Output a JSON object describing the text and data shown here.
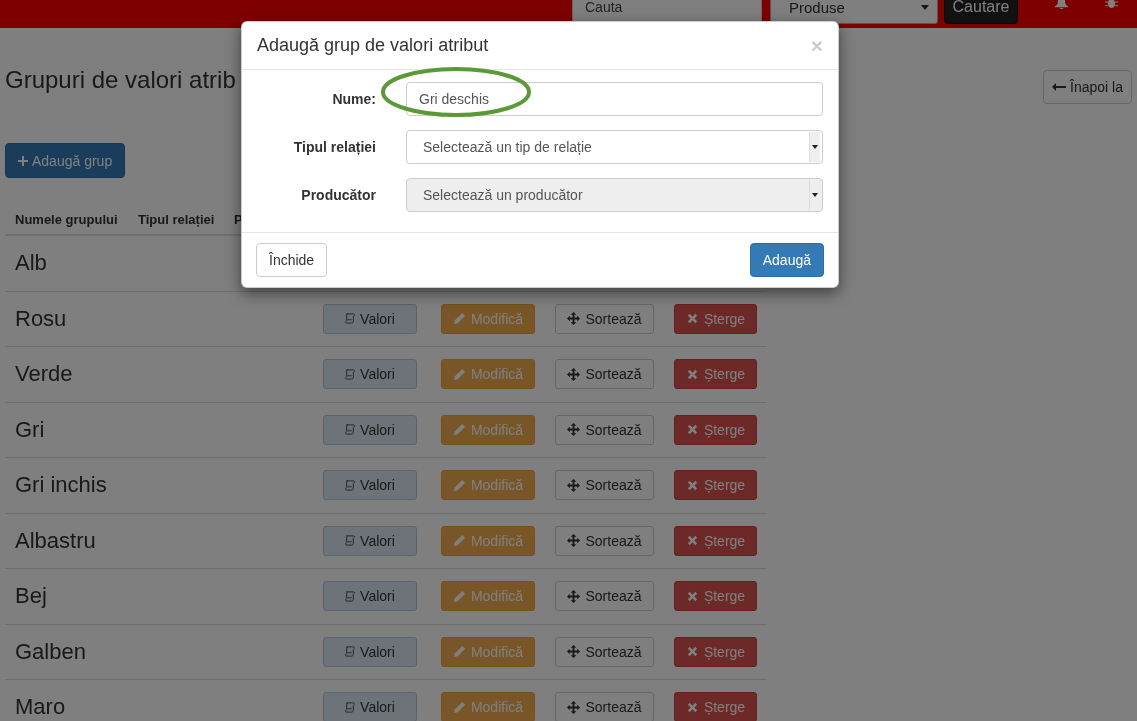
{
  "navbar": {
    "search": {
      "placeholder": "Cauta"
    },
    "category_select": {
      "value": "Produse"
    },
    "search_button": "Cautare"
  },
  "page": {
    "title": "Grupuri de valori atrib",
    "back_button": "Înapoi la",
    "add_button": "Adaugă grup",
    "table": {
      "columns": [
        "Numele grupului",
        "Tipul relației",
        "P"
      ],
      "rows": [
        {
          "name": "Alb"
        },
        {
          "name": "Rosu",
          "buttons": [
            {
              "kind": "values",
              "label": "Valori"
            },
            {
              "kind": "edit",
              "label": "Modifică"
            },
            {
              "kind": "sort",
              "label": "Sortează"
            },
            {
              "kind": "delete",
              "label": "Șterge"
            }
          ]
        },
        {
          "name": "Verde",
          "buttons": [
            {
              "kind": "values",
              "label": "Valori"
            },
            {
              "kind": "edit",
              "label": "Modifică"
            },
            {
              "kind": "sort",
              "label": "Sortează"
            },
            {
              "kind": "delete",
              "label": "Șterge"
            }
          ]
        },
        {
          "name": "Gri",
          "buttons": [
            {
              "kind": "values",
              "label": "Valori"
            },
            {
              "kind": "edit",
              "label": "Modifică"
            },
            {
              "kind": "sort",
              "label": "Sortează"
            },
            {
              "kind": "delete",
              "label": "Șterge"
            }
          ]
        },
        {
          "name": "Gri inchis",
          "buttons": [
            {
              "kind": "values",
              "label": "Valori"
            },
            {
              "kind": "edit",
              "label": "Modifică"
            },
            {
              "kind": "sort",
              "label": "Sortează"
            },
            {
              "kind": "delete",
              "label": "Șterge"
            }
          ]
        },
        {
          "name": "Albastru",
          "buttons": [
            {
              "kind": "values",
              "label": "Valori"
            },
            {
              "kind": "edit",
              "label": "Modifică"
            },
            {
              "kind": "sort",
              "label": "Sortează"
            },
            {
              "kind": "delete",
              "label": "Șterge"
            }
          ]
        },
        {
          "name": "Bej",
          "buttons": [
            {
              "kind": "values",
              "label": "Valori"
            },
            {
              "kind": "edit",
              "label": "Modifică"
            },
            {
              "kind": "sort",
              "label": "Sortează"
            },
            {
              "kind": "delete",
              "label": "Șterge"
            }
          ]
        },
        {
          "name": "Galben",
          "buttons": [
            {
              "kind": "values",
              "label": "Valori"
            },
            {
              "kind": "edit",
              "label": "Modifică"
            },
            {
              "kind": "sort",
              "label": "Sortează"
            },
            {
              "kind": "delete",
              "label": "Șterge"
            }
          ]
        },
        {
          "name": "Maro",
          "buttons": [
            {
              "kind": "values",
              "label": "Valori"
            },
            {
              "kind": "edit",
              "label": "Modifică"
            },
            {
              "kind": "sort",
              "label": "Sortează"
            },
            {
              "kind": "delete",
              "label": "Șterge"
            }
          ]
        }
      ]
    }
  },
  "modal": {
    "title": "Adaugă grup de valori atribut",
    "close": "×",
    "fields": [
      {
        "label": "Nume:",
        "kind": "text",
        "value": "Gri deschis",
        "disabled": false,
        "highlighted": true
      },
      {
        "label": "Tipul relației",
        "kind": "select",
        "value": "Selectează un tip de relație",
        "disabled": false,
        "highlighted": false
      },
      {
        "label": "Producător",
        "kind": "select",
        "value": "Selectează un producător",
        "disabled": true,
        "highlighted": false
      }
    ],
    "buttons": [
      {
        "kind": "default",
        "label": "Închide"
      },
      {
        "kind": "primary",
        "label": "Adaugă"
      }
    ]
  }
}
